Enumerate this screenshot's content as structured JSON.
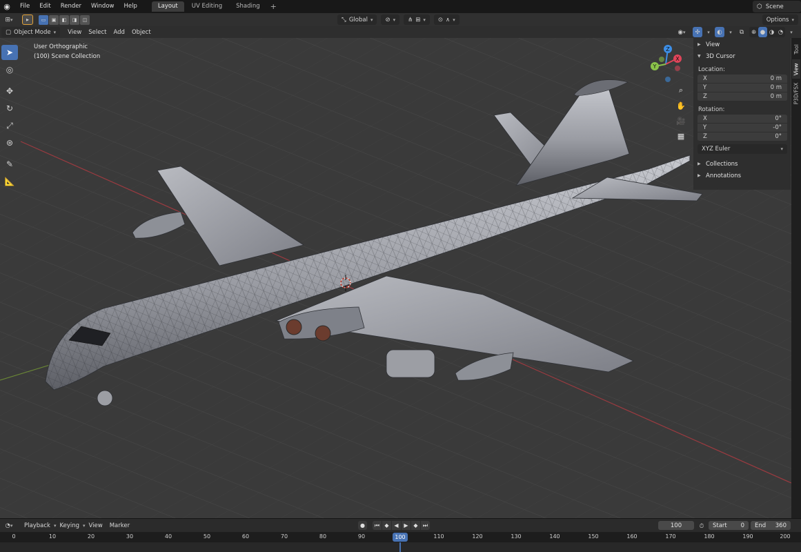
{
  "menubar": {
    "items": [
      "File",
      "Edit",
      "Render",
      "Window",
      "Help"
    ],
    "workspaces": [
      {
        "label": "Layout",
        "active": true
      },
      {
        "label": "UV Editing",
        "active": false
      },
      {
        "label": "Shading",
        "active": false
      }
    ],
    "add_workspace": "+",
    "scene": "Scene"
  },
  "header": {
    "transform_orientation": "Global",
    "options": "Options",
    "mode": "Object Mode",
    "menus": [
      "View",
      "Select",
      "Add",
      "Object"
    ]
  },
  "viewport": {
    "view_name": "User Orthographic",
    "collection": "(100) Scene Collection"
  },
  "gizmo": {
    "x": "X",
    "y": "Y",
    "z": "Z",
    "colors": {
      "x": "#e0455a",
      "y": "#8bc34a",
      "z": "#3d8fe8"
    }
  },
  "npanel": {
    "view_header": "View",
    "cursor_header": "3D Cursor",
    "location_label": "Location:",
    "location": [
      {
        "axis": "X",
        "value": "0 m"
      },
      {
        "axis": "Y",
        "value": "0 m"
      },
      {
        "axis": "Z",
        "value": "0 m"
      }
    ],
    "rotation_label": "Rotation:",
    "rotation": [
      {
        "axis": "X",
        "value": "0°"
      },
      {
        "axis": "Y",
        "value": "-0°"
      },
      {
        "axis": "Z",
        "value": "0°"
      }
    ],
    "rotation_mode": "XYZ Euler",
    "collections": "Collections",
    "annotations": "Annotations"
  },
  "sidetabs": [
    "Tool",
    "View",
    "P3D/FSX"
  ],
  "timeline": {
    "menus": [
      "Playback",
      "Keying",
      "View",
      "Marker"
    ],
    "current_frame": "100",
    "start_label": "Start",
    "start": "0",
    "end_label": "End",
    "end": "360",
    "ticks": [
      "0",
      "10",
      "20",
      "30",
      "40",
      "50",
      "60",
      "70",
      "80",
      "90",
      "100",
      "110",
      "120",
      "130",
      "140",
      "150",
      "160",
      "170",
      "180",
      "190",
      "200"
    ],
    "accent": "#4772b3"
  }
}
